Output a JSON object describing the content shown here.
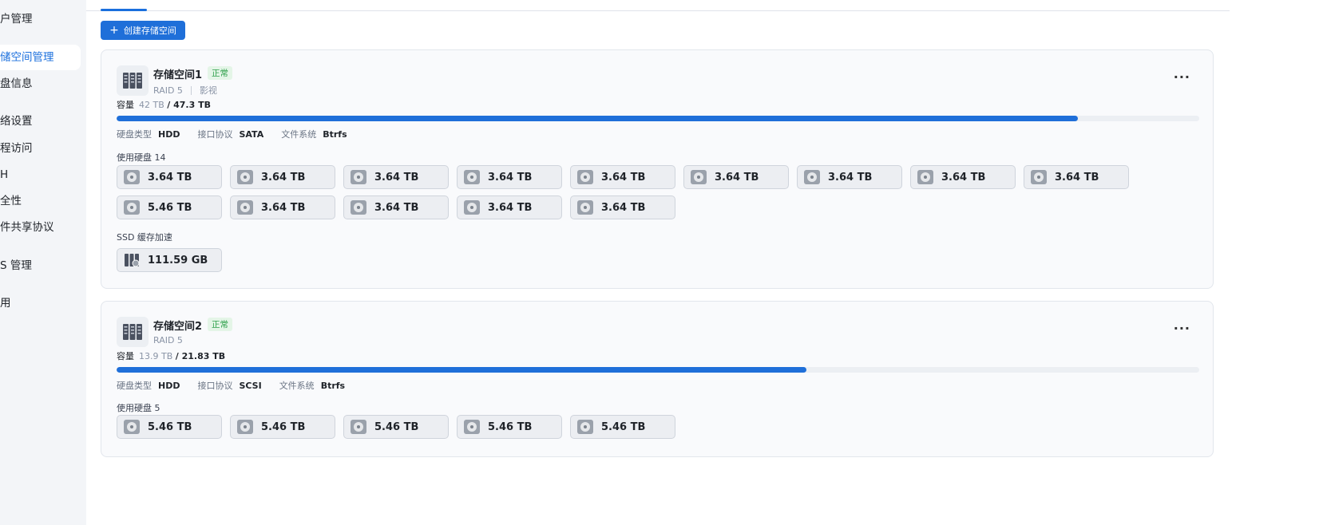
{
  "sidebar": {
    "items": [
      {
        "label": "户管理",
        "active": false
      },
      {
        "label": "储空间管理",
        "active": true
      },
      {
        "label": "盘信息",
        "active": false
      },
      {
        "label": "络设置",
        "active": false
      },
      {
        "label": "程访问",
        "active": false
      },
      {
        "label": "H",
        "active": false
      },
      {
        "label": "全性",
        "active": false
      },
      {
        "label": "件共享协议",
        "active": false
      },
      {
        "label": "S 管理",
        "active": false
      },
      {
        "label": "用",
        "active": false
      }
    ]
  },
  "toolbar": {
    "create_plus": "+",
    "create_label": "创建存储空间"
  },
  "pools": [
    {
      "title": "存储空间1",
      "status": "正常",
      "raid": "RAID 5",
      "tag": "影视",
      "capacity_label": "容量",
      "used": "42 TB",
      "total": "/ 47.3 TB",
      "usage_fraction": 0.888,
      "props": [
        {
          "k": "硬盘类型",
          "v": "HDD"
        },
        {
          "k": "接口协议",
          "v": "SATA"
        },
        {
          "k": "文件系统",
          "v": "Btrfs"
        }
      ],
      "disks_label": "使用硬盘 14",
      "disks": [
        "3.64 TB",
        "3.64 TB",
        "3.64 TB",
        "3.64 TB",
        "3.64 TB",
        "3.64 TB",
        "3.64 TB",
        "3.64 TB",
        "3.64 TB",
        "5.46 TB",
        "3.64 TB",
        "3.64 TB",
        "3.64 TB",
        "3.64 TB"
      ],
      "ssd_label": "SSD 缓存加速",
      "ssd": [
        "111.59 GB"
      ],
      "more": "···"
    },
    {
      "title": "存储空间2",
      "status": "正常",
      "raid": "RAID 5",
      "capacity_label": "容量",
      "used": "13.9 TB",
      "total": "/ 21.83 TB",
      "usage_fraction": 0.637,
      "props": [
        {
          "k": "硬盘类型",
          "v": "HDD"
        },
        {
          "k": "接口协议",
          "v": "SCSI"
        },
        {
          "k": "文件系统",
          "v": "Btrfs"
        }
      ],
      "disks_label": "使用硬盘 5",
      "disks": [
        "5.46 TB",
        "5.46 TB",
        "5.46 TB",
        "5.46 TB",
        "5.46 TB"
      ],
      "more": "···"
    }
  ],
  "colors": {
    "accent": "#1f6fd9",
    "status_ok": "#2fa14c"
  }
}
